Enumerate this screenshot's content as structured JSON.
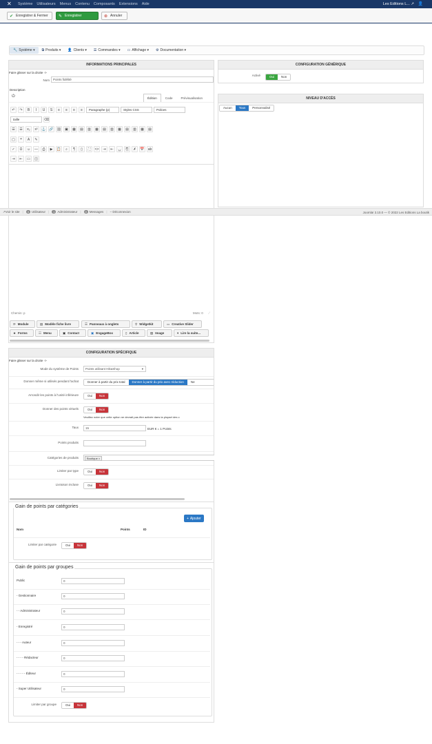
{
  "topnav": {
    "menu": [
      "Système",
      "Utilisateurs",
      "Menus",
      "Contenu",
      "Composants",
      "Extensions",
      "Aide"
    ],
    "site": "Les Editions L... ↗",
    "user_icon": "user-icon"
  },
  "toolbar": {
    "save_close": "Enregistrer & Fermer",
    "save": "Enregistrer",
    "cancel": "Annuler"
  },
  "subnav": [
    {
      "label": "Système",
      "icon": "wrench-icon"
    },
    {
      "label": "Produits",
      "icon": "cubes-icon"
    },
    {
      "label": "Clients",
      "icon": "user-icon"
    },
    {
      "label": "Commandes",
      "icon": "list-icon"
    },
    {
      "label": "Affichage",
      "icon": "monitor-icon"
    },
    {
      "label": "Documentation",
      "icon": "gear-icon"
    }
  ],
  "main_panel": {
    "title": "INFORMATIONS PRINCIPALES",
    "drag_hint": "Faire glisser sur la droite ->",
    "name_label": "Nom",
    "name_value": "Points fidélité",
    "description_label": "Description",
    "tabs": [
      "Édition",
      "Code",
      "Prévisualisation"
    ],
    "format_select": "Paragraphe (p)",
    "styles_select": "Styles CSS",
    "fonts_select": "Polices",
    "size_select": "taille",
    "path_label": "Chemin: p",
    "words_label": "Mots: 0",
    "ext_buttons_row1": [
      "Module",
      "Modèle fiche livre",
      "Panneaux à onglets",
      "Widgetkit",
      "Creative Slider"
    ],
    "ext_buttons_row2": [
      "Forms",
      "Menu",
      "Contact",
      "EngageBox",
      "Article",
      "Image",
      "Lire la suite..."
    ]
  },
  "generic_panel": {
    "title": "CONFIGURATION GÉNÉRIQUE",
    "active_label": "Activé",
    "yes": "Oui",
    "no": "Non"
  },
  "access_panel": {
    "title": "NIVEAU D'ACCÈS",
    "options": [
      "Aucun",
      "Tous",
      "Personnalisé"
    ]
  },
  "statusbar": {
    "view_site": "Voir le site",
    "visitors_count": "0",
    "visitors": "Utilisateur",
    "admins_count": "1",
    "admins": "Administrateur",
    "messages_count": "0",
    "messages": "Messages",
    "logout": "Déconnexion",
    "version": "Joomla! 3.10.0 — © 2022 Les Editions La boutik"
  },
  "specific_panel": {
    "title": "CONFIGURATION SPÉCIFIQUE",
    "drag_hint": "Faire glisser sur la droite ->",
    "mode_label": "Mode du système de Points",
    "mode_value": "Points utilisant HikaShop",
    "give_label": "Donner même si utilisés pendant l'achat",
    "give_opt1": "Donner à partir du prix total",
    "give_opt2": "Donner à partir du prix avec réduction",
    "give_opt3": "Ne",
    "round_label": "Arrondir les points à l'unité inférieure",
    "virtual_label": "Donner des points virtuels",
    "virtual_note": "Veuillez noter que cette option ne devrait pas être activée dans la plupart des c",
    "rate_label": "Taux",
    "rate_value": "15",
    "rate_unit": "EUR € = 1 Points",
    "product_points_label": "Points produits",
    "categories_label": "Catégories de produits",
    "category_chip": "Boutique ×",
    "limit_type_label": "Limiter par type",
    "shipping_label": "Livraison incluse",
    "yes": "Oui",
    "no": "Non"
  },
  "cat_gain": {
    "legend": "Gain de points par catégories",
    "add": "Ajouter",
    "col_name": "Nom",
    "col_points": "Points",
    "col_id": "ID",
    "limit_label": "Limiter par catégorie",
    "yes": "Oui",
    "no": "Non"
  },
  "group_gain": {
    "legend": "Gain de points par groupes",
    "groups": [
      {
        "label": "Public",
        "value": "0"
      },
      {
        "label": "- Gestionnaire",
        "value": "0"
      },
      {
        "label": "- - Administrateur",
        "value": "0"
      },
      {
        "label": "- Enregistré",
        "value": "0"
      },
      {
        "label": "- - - Auteur",
        "value": "0"
      },
      {
        "label": "- - - - Rédacteur",
        "value": "0"
      },
      {
        "label": "- - - - - Éditeur",
        "value": "0"
      },
      {
        "label": "- Super Utilisateur",
        "value": "0"
      }
    ],
    "limit_label": "Limiter par groupe",
    "yes": "Oui",
    "no": "Non"
  }
}
